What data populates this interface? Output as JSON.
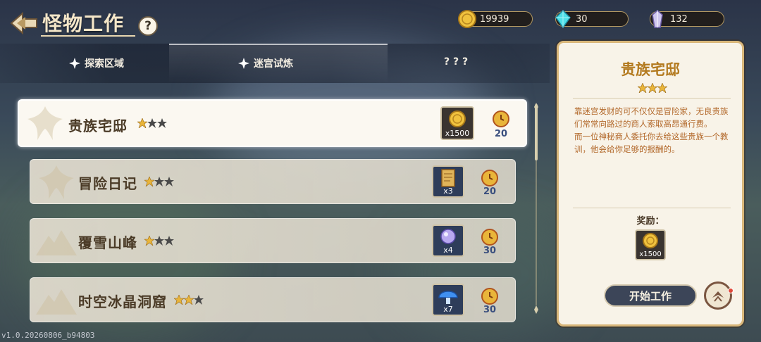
{
  "header": {
    "title": "怪物工作",
    "help": "?"
  },
  "currencies": [
    {
      "name": "gold-coin",
      "value": "19939"
    },
    {
      "name": "cyan-crystal",
      "value": "30"
    },
    {
      "name": "purple-crystal",
      "value": "132"
    }
  ],
  "tabs": [
    {
      "label": "探索区域"
    },
    {
      "label": "迷宫试炼"
    },
    {
      "label": "? ? ?"
    }
  ],
  "quests": [
    {
      "name": "贵族宅邸",
      "stars": 1,
      "reward_qty": "x1500",
      "reward_icon": "gold-coin",
      "time": "20"
    },
    {
      "name": "冒险日记",
      "stars": 1,
      "reward_qty": "x3",
      "reward_icon": "scroll",
      "time": "20"
    },
    {
      "name": "覆雪山峰",
      "stars": 1,
      "reward_qty": "x4",
      "reward_icon": "crystal-orb",
      "time": "30"
    },
    {
      "name": "时空冰晶洞窟",
      "stars": 2,
      "reward_qty": "x7",
      "reward_icon": "blue-mushroom",
      "time": "30"
    }
  ],
  "detail": {
    "title": "贵族宅邸",
    "stars": 3,
    "description_1": "靠迷宫发财的可不仅仅是冒险家，无良贵族们常常向路过的商人索取高昂通行费。",
    "description_2": "而一位神秘商人委托你去给这些贵族一个教训，他会给你足够的报酬的。",
    "reward_label": "奖励：",
    "reward_qty": "x1500",
    "start_button": "开始工作"
  },
  "version": "v1.0.20260806_b94803",
  "colors": {
    "gold": "#e9b53a",
    "title_orange": "#b37a1f",
    "time_blue": "#3a4f7e"
  }
}
